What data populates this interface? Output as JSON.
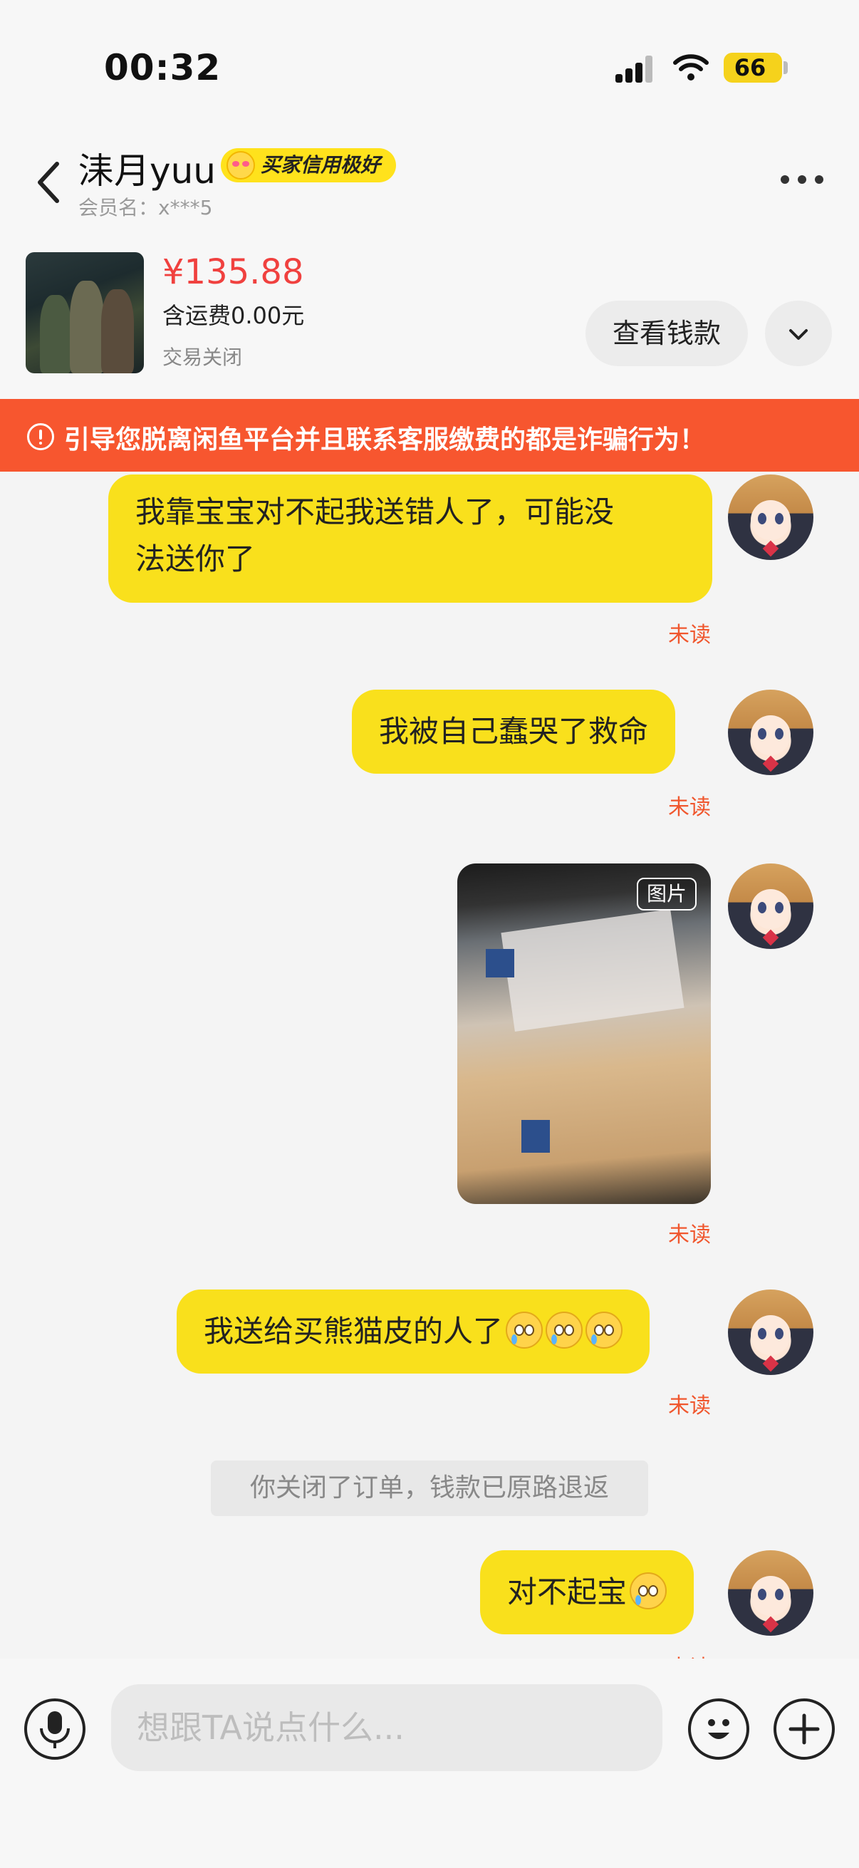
{
  "status_bar": {
    "time": "00:32",
    "battery": "66"
  },
  "header": {
    "seller_name": "洡月yuu",
    "credit_badge": "买家信用极好",
    "member_name": "会员名：x***5"
  },
  "product": {
    "price": "¥135.88",
    "shipping": "含运费0.00元",
    "status": "交易关闭",
    "view_funds_label": "查看钱款"
  },
  "warning": {
    "text": "引导您脱离闲鱼平台并且联系客服缴费的都是诈骗行为！"
  },
  "messages": [
    {
      "line1": "我靠宝宝对不起我送错人了，可能没",
      "line2": "法送你了",
      "status": "未读"
    },
    {
      "text": "我被自己蠢哭了救命",
      "status": "未读"
    },
    {
      "image_tag": "图片",
      "status": "未读"
    },
    {
      "text": "我送给买熊猫皮的人了",
      "status": "未读"
    },
    {
      "text": "对不起宝",
      "status": "未读"
    }
  ],
  "system_message": "你关闭了订单，钱款已原路退返",
  "input": {
    "placeholder": "想跟TA说点什么..."
  },
  "colors": {
    "accent_yellow": "#f9e01c",
    "warning_orange": "#f7562f",
    "price_red": "#f0413f",
    "unread_orange": "#f0572e"
  }
}
